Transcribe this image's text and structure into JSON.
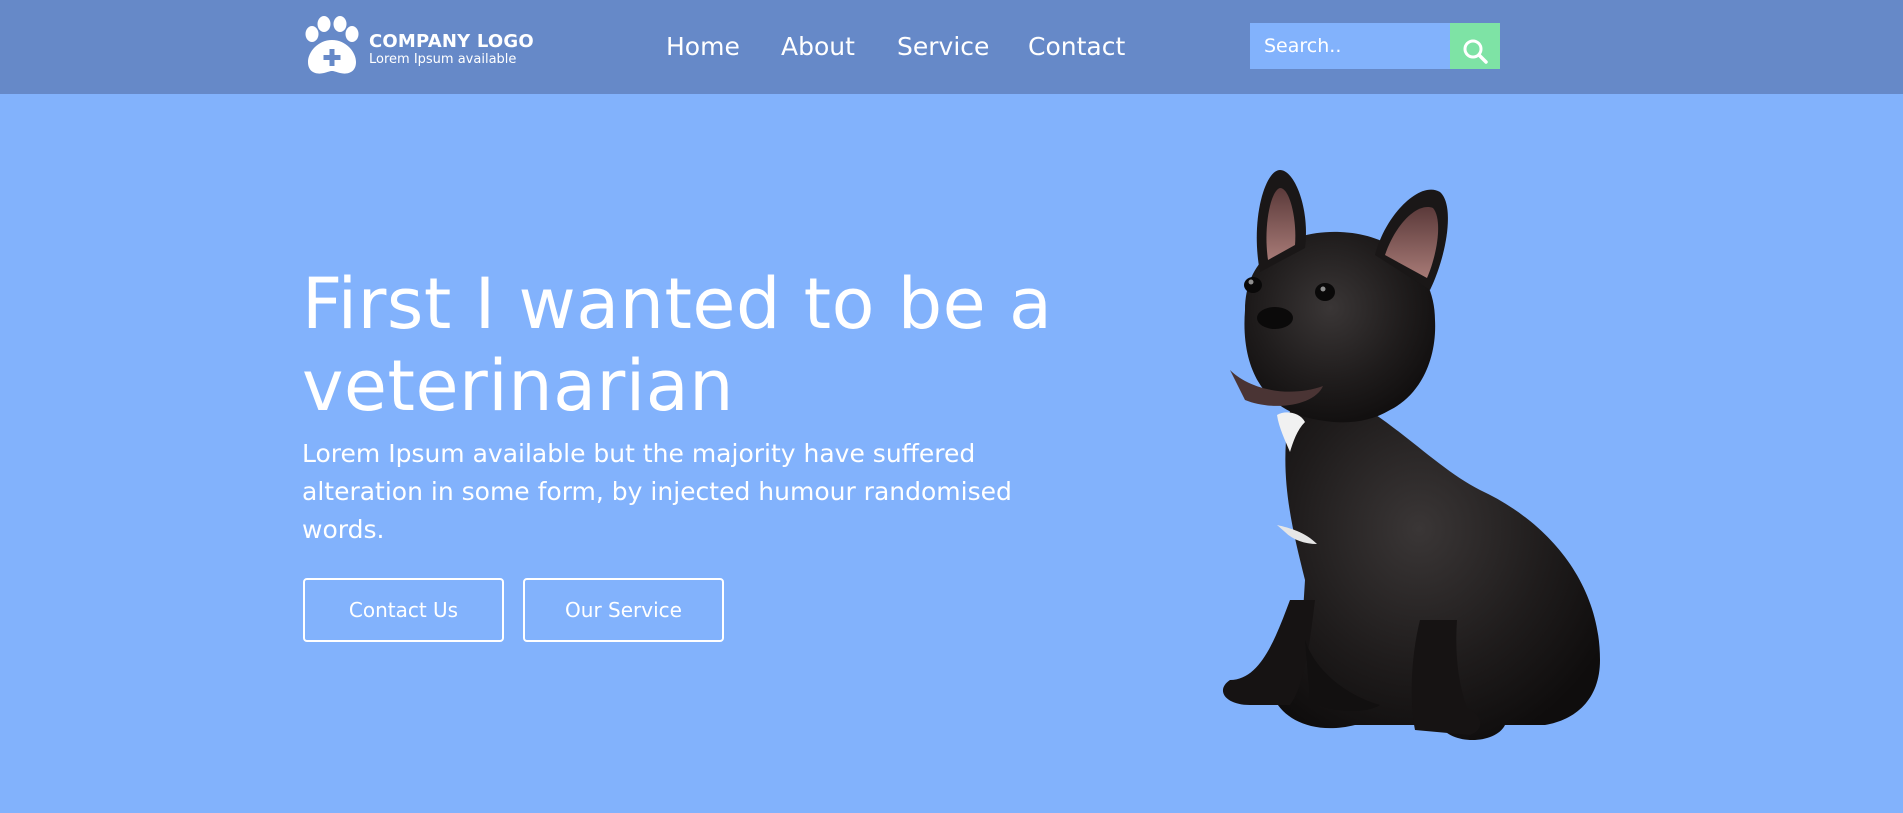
{
  "brand": {
    "title": "COMPANY LOGO",
    "subtitle": "Lorem Ipsum available",
    "icon": "paw-plus-icon"
  },
  "nav": {
    "items": [
      "Home",
      "About",
      "Service",
      "Contact"
    ]
  },
  "search": {
    "placeholder": "Search..",
    "value": "",
    "icon": "search-icon"
  },
  "hero": {
    "title": "First I wanted to be a veterinarian",
    "text": "Lorem Ipsum available but the majority have suffered alteration in some form, by injected humour randomised words.",
    "buttons": {
      "contact": "Contact Us",
      "service": "Our Service"
    },
    "image": "french-bulldog-photo"
  },
  "colors": {
    "header": "#6689c8",
    "background": "#82b2fc",
    "search_button": "#7ee3a5",
    "text": "#ffffff"
  }
}
